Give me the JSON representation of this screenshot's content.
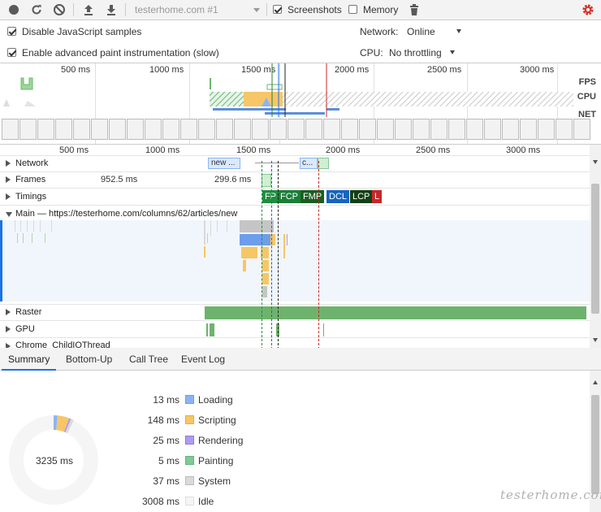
{
  "toolbar": {
    "url_select": "testerhome.com #1",
    "screenshots_label": "Screenshots",
    "screenshots_checked": true,
    "memory_label": "Memory",
    "memory_checked": false
  },
  "settings": {
    "disable_js_label": "Disable JavaScript samples",
    "paint_label": "Enable advanced paint instrumentation (slow)",
    "network_label": "Network:",
    "network_value": "Online",
    "cpu_label": "CPU:",
    "cpu_value": "No throttling"
  },
  "overview": {
    "ticks": [
      "500 ms",
      "1000 ms",
      "1500 ms",
      "2000 ms",
      "2500 ms",
      "3000 ms"
    ],
    "fps_label": "FPS",
    "cpu_label": "CPU",
    "net_label": "NET"
  },
  "flame": {
    "ticks": [
      "500 ms",
      "1000 ms",
      "1500 ms",
      "2000 ms",
      "2500 ms",
      "3000 ms"
    ],
    "tracks": {
      "network": "Network",
      "frames": "Frames",
      "timings": "Timings",
      "main": "Main — https://testerhome.com/columns/62/articles/new",
      "raster": "Raster",
      "gpu": "GPU",
      "child_io": "Chrome_ChildIOThread"
    },
    "network_items": [
      "new ...",
      "c..."
    ],
    "frame_times": [
      "952.5 ms",
      "299.6 ms"
    ],
    "timing_markers": [
      {
        "label": "FP",
        "color": "#1e8e3e"
      },
      {
        "label": "FCP",
        "color": "#1a7f37"
      },
      {
        "label": "FMP",
        "color": "#1b5e20"
      },
      {
        "label": "DCL",
        "color": "#1565c0"
      },
      {
        "label": "LCP",
        "color": "#124116"
      },
      {
        "label": "L",
        "color": "#c62828"
      }
    ]
  },
  "tabs": [
    "Summary",
    "Bottom-Up",
    "Call Tree",
    "Event Log"
  ],
  "summary": {
    "total": "3235 ms",
    "rows": [
      {
        "value": "13 ms",
        "name": "Loading",
        "color": "#8ab4f8"
      },
      {
        "value": "148 ms",
        "name": "Scripting",
        "color": "#f6c667"
      },
      {
        "value": "25 ms",
        "name": "Rendering",
        "color": "#af9cf0"
      },
      {
        "value": "5 ms",
        "name": "Painting",
        "color": "#81c995"
      },
      {
        "value": "37 ms",
        "name": "System",
        "color": "#dadada"
      },
      {
        "value": "3008 ms",
        "name": "Idle",
        "color": "#f5f5f5"
      }
    ]
  },
  "watermark": "testerhome.com"
}
